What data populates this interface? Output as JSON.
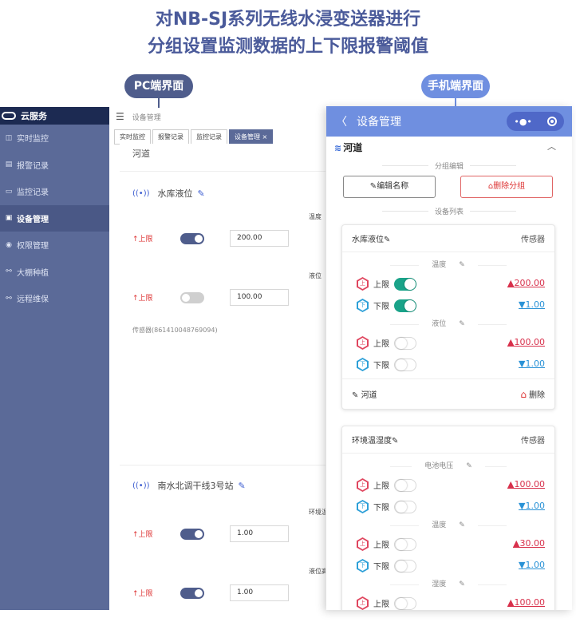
{
  "headline": {
    "line1": "对NB-SJ系列无线水浸变送器进行",
    "line2": "分组设置监测数据的上下限报警阈值"
  },
  "labels": {
    "pc": "PC端界面",
    "mobile": "手机端界面"
  },
  "pc": {
    "brand": "云服务",
    "nav": [
      {
        "icon": "monitor-icon",
        "glyph": "◫",
        "label": "实时监控"
      },
      {
        "icon": "alarm-log-icon",
        "glyph": "▤",
        "label": "报警记录"
      },
      {
        "icon": "camera-icon",
        "glyph": "▭",
        "label": "监控记录"
      },
      {
        "icon": "device-icon",
        "glyph": "▣",
        "label": "设备管理",
        "active": true
      },
      {
        "icon": "permission-icon",
        "glyph": "◉",
        "label": "权限管理"
      },
      {
        "icon": "greenhouse-icon",
        "glyph": "⚯",
        "label": "大棚种植"
      },
      {
        "icon": "maintenance-icon",
        "glyph": "⚯",
        "label": "远程维保"
      }
    ],
    "breadcrumb": "设备管理",
    "tabs": [
      "实时监控",
      "报警记录",
      "监控记录",
      "设备管理 ×"
    ],
    "group_name": "河道",
    "devices": [
      {
        "name": "水库液位",
        "rows": [
          {
            "limit": "上限",
            "on": true,
            "value": "200.00",
            "side": "温度"
          },
          {
            "limit": "上限",
            "on": false,
            "value": "100.00",
            "side": "液位"
          }
        ],
        "sensor": "传感器(861410048769094)"
      },
      {
        "name": "南水北调干线3号站",
        "rows": [
          {
            "limit": "上限",
            "on": true,
            "value": "1.00",
            "side": "环境温"
          },
          {
            "limit": "上限",
            "on": true,
            "value": "1.00",
            "side": "液位高"
          }
        ]
      }
    ]
  },
  "mobile": {
    "title": "设备管理",
    "group_name": "河道",
    "group_edit": "分组编辑",
    "rename_button": "编辑名称",
    "delete_group_button": "删除分组",
    "device_list": "设备列表",
    "cards": [
      {
        "name": "水库液位",
        "type": "传感器",
        "sections": [
          {
            "title": "温度",
            "rows": [
              {
                "dir": "up",
                "hex": "上",
                "label": "上限",
                "on": true,
                "value": "200.00",
                "arrow": "▲"
              },
              {
                "dir": "down",
                "hex": "下",
                "label": "下限",
                "on": true,
                "value": "1.00",
                "arrow": "▼"
              }
            ]
          },
          {
            "title": "液位",
            "rows": [
              {
                "dir": "up",
                "hex": "上",
                "label": "上限",
                "on": false,
                "value": "100.00",
                "arrow": "▲"
              },
              {
                "dir": "down",
                "hex": "下",
                "label": "下限",
                "on": false,
                "value": "1.00",
                "arrow": "▼"
              }
            ]
          }
        ],
        "footer_group": "河道",
        "footer_delete": "删除"
      },
      {
        "name": "环境温湿度",
        "type": "传感器",
        "sections": [
          {
            "title": "电池电压",
            "rows": [
              {
                "dir": "up",
                "hex": "上",
                "label": "上限",
                "on": false,
                "value": "100.00",
                "arrow": "▲"
              },
              {
                "dir": "down",
                "hex": "下",
                "label": "下限",
                "on": false,
                "value": "1.00",
                "arrow": "▼"
              }
            ]
          },
          {
            "title": "温度",
            "rows": [
              {
                "dir": "up",
                "hex": "上",
                "label": "上限",
                "on": false,
                "value": "30.00",
                "arrow": "▲"
              },
              {
                "dir": "down",
                "hex": "下",
                "label": "下限",
                "on": false,
                "value": "1.00",
                "arrow": "▼"
              }
            ]
          },
          {
            "title": "湿度",
            "rows": [
              {
                "dir": "up",
                "hex": "上",
                "label": "上限",
                "on": false,
                "value": "100.00",
                "arrow": "▲"
              }
            ]
          }
        ]
      }
    ]
  }
}
